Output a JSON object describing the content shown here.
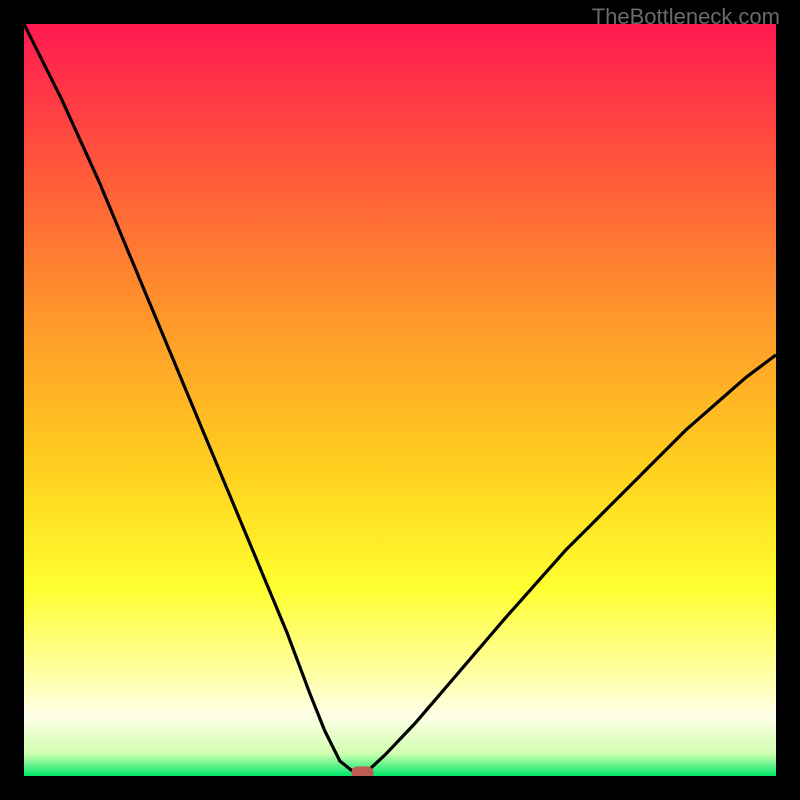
{
  "watermark": "TheBottleneck.com",
  "chart_data": {
    "type": "line",
    "title": "",
    "xlabel": "",
    "ylabel": "",
    "xlim": [
      0,
      100
    ],
    "ylim": [
      0,
      100
    ],
    "grid": false,
    "legend": false,
    "background": "rainbow-gradient",
    "gradient_stops": [
      {
        "offset": 0.0,
        "color": "#ff1a50"
      },
      {
        "offset": 0.2,
        "color": "#ff5a3a"
      },
      {
        "offset": 0.4,
        "color": "#ff9a2a"
      },
      {
        "offset": 0.6,
        "color": "#ffd21f"
      },
      {
        "offset": 0.75,
        "color": "#ffff30"
      },
      {
        "offset": 0.86,
        "color": "#ffffa0"
      },
      {
        "offset": 0.92,
        "color": "#ffffe8"
      },
      {
        "offset": 0.97,
        "color": "#d0ffb0"
      },
      {
        "offset": 1.0,
        "color": "#00e86a"
      }
    ],
    "series": [
      {
        "name": "bottleneck-curve",
        "x": [
          0,
          5,
          10,
          15,
          20,
          25,
          30,
          35,
          38,
          40,
          42,
          44,
          45,
          48,
          52,
          58,
          64,
          72,
          80,
          88,
          96,
          100
        ],
        "y": [
          100,
          90,
          79,
          67,
          55,
          43,
          31,
          19,
          11,
          6,
          2,
          0.4,
          0,
          2.8,
          7,
          14,
          21,
          30,
          38,
          46,
          53,
          56
        ]
      }
    ],
    "marker": {
      "name": "optimal-point",
      "x": 45,
      "y": 0,
      "color": "#c05a55"
    }
  }
}
